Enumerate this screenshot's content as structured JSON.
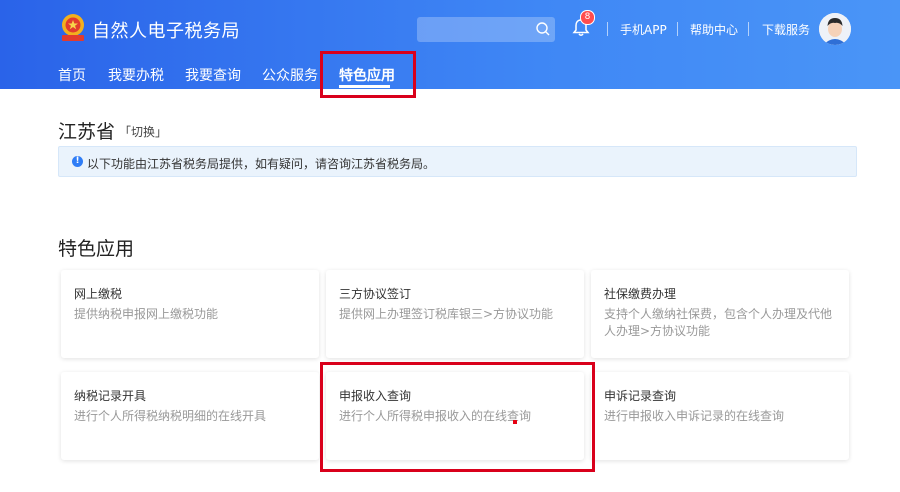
{
  "header": {
    "brand": "自然人电子税务局",
    "notification_count": "8",
    "links": [
      "手机APP",
      "帮助中心",
      "下载服务"
    ]
  },
  "nav": {
    "items": [
      "首页",
      "我要办税",
      "我要查询",
      "公众服务",
      "特色应用"
    ],
    "active": "特色应用"
  },
  "province": {
    "name": "江苏省",
    "switch_label": "「切换」"
  },
  "notice": {
    "icon": "!",
    "text": "以下功能由江苏省税务局提供，如有疑问，请咨询江苏省税务局。"
  },
  "section": {
    "title": "特色应用"
  },
  "cards": [
    {
      "title": "网上缴税",
      "desc": "提供纳税申报网上缴税功能"
    },
    {
      "title": "三方协议签订",
      "desc": "提供网上办理签订税库银三>方协议功能"
    },
    {
      "title": "社保缴费办理",
      "desc": "支持个人缴纳社保费，包含个人办理及代他人办理>方协议功能"
    },
    {
      "title": "纳税记录开具",
      "desc": "进行个人所得税纳税明细的在线开具"
    },
    {
      "title": "申报收入查询",
      "desc": "进行个人所得税申报收入的在线查询"
    },
    {
      "title": "申诉记录查询",
      "desc": "进行申报收入申诉记录的在线查询"
    }
  ],
  "colors": {
    "header_start": "#2a63e9",
    "header_end": "#4a95f7",
    "highlight": "#d9001b",
    "badge": "#ff4d4f",
    "notice_bg": "#eaf3fc"
  }
}
